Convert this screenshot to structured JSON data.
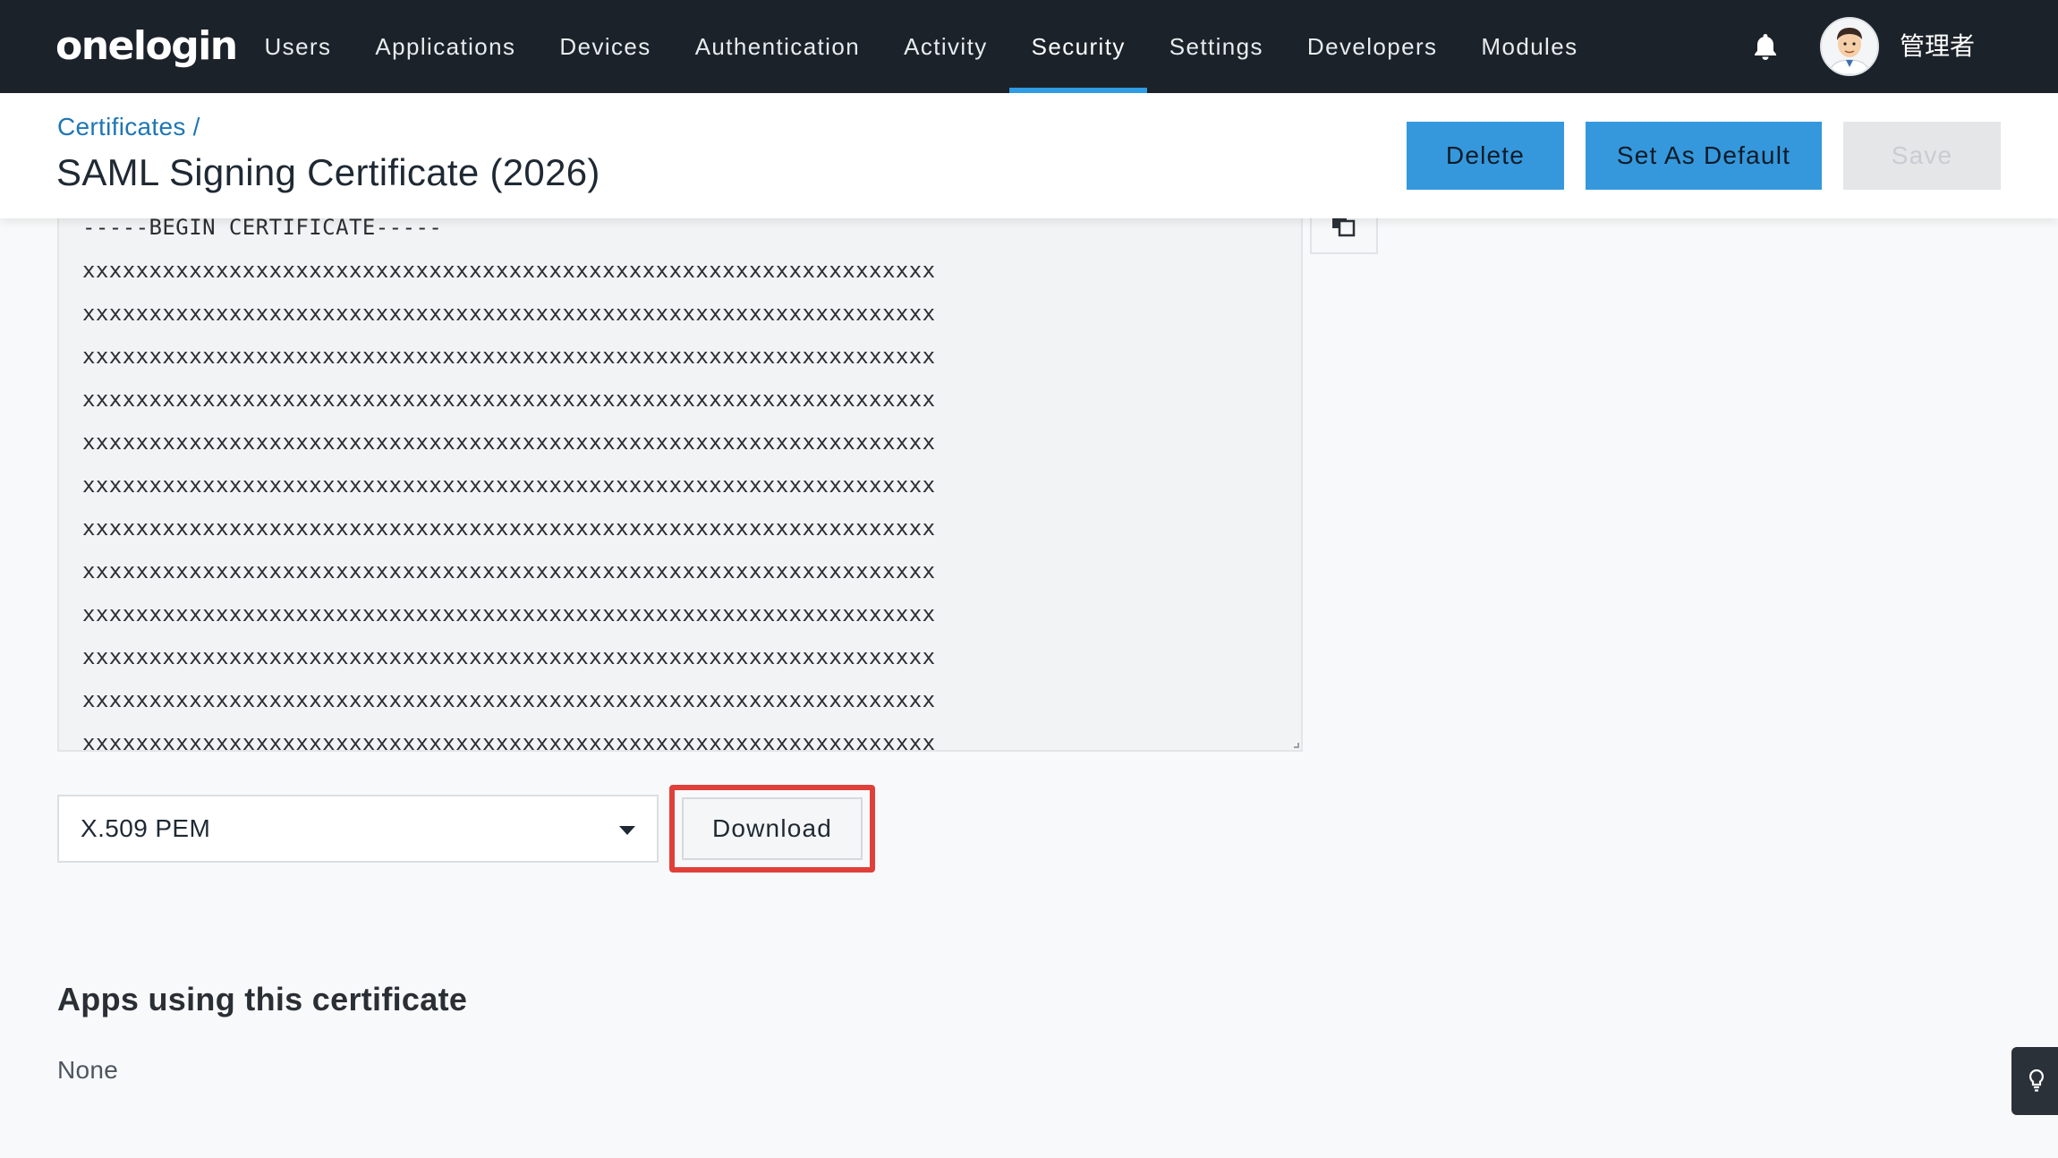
{
  "brand": {
    "logo_text": "onelogin",
    "accent_color": "#2f9be3",
    "nav_bg": "#1c2229"
  },
  "nav": {
    "items": [
      {
        "label": "Users"
      },
      {
        "label": "Applications"
      },
      {
        "label": "Devices"
      },
      {
        "label": "Authentication"
      },
      {
        "label": "Activity"
      },
      {
        "label": "Security",
        "active": true
      },
      {
        "label": "Settings"
      },
      {
        "label": "Developers"
      },
      {
        "label": "Modules"
      }
    ],
    "notification_icon": "bell-icon",
    "user_name": "管理者"
  },
  "header": {
    "breadcrumb": "Certificates",
    "breadcrumb_separator": "/",
    "title": "SAML Signing Certificate (2026)",
    "buttons": {
      "delete": "Delete",
      "set_default": "Set As Default",
      "save": "Save"
    }
  },
  "certificate": {
    "lines": [
      "-----BEGIN CERTIFICATE-----",
      "xxxxxxxxxxxxxxxxxxxxxxxxxxxxxxxxxxxxxxxxxxxxxxxxxxxxxxxxxxxxxxxx",
      "xxxxxxxxxxxxxxxxxxxxxxxxxxxxxxxxxxxxxxxxxxxxxxxxxxxxxxxxxxxxxxxx",
      "xxxxxxxxxxxxxxxxxxxxxxxxxxxxxxxxxxxxxxxxxxxxxxxxxxxxxxxxxxxxxxxx",
      "xxxxxxxxxxxxxxxxxxxxxxxxxxxxxxxxxxxxxxxxxxxxxxxxxxxxxxxxxxxxxxxx",
      "xxxxxxxxxxxxxxxxxxxxxxxxxxxxxxxxxxxxxxxxxxxxxxxxxxxxxxxxxxxxxxxx",
      "xxxxxxxxxxxxxxxxxxxxxxxxxxxxxxxxxxxxxxxxxxxxxxxxxxxxxxxxxxxxxxxx",
      "xxxxxxxxxxxxxxxxxxxxxxxxxxxxxxxxxxxxxxxxxxxxxxxxxxxxxxxxxxxxxxxx",
      "xxxxxxxxxxxxxxxxxxxxxxxxxxxxxxxxxxxxxxxxxxxxxxxxxxxxxxxxxxxxxxxx",
      "xxxxxxxxxxxxxxxxxxxxxxxxxxxxxxxxxxxxxxxxxxxxxxxxxxxxxxxxxxxxxxxx",
      "xxxxxxxxxxxxxxxxxxxxxxxxxxxxxxxxxxxxxxxxxxxxxxxxxxxxxxxxxxxxxxxx",
      "xxxxxxxxxxxxxxxxxxxxxxxxxxxxxxxxxxxxxxxxxxxxxxxxxxxxxxxxxxxxxxxx",
      "xxxxxxxxxxxxxxxxxxxxxxxxxxxxxxxxxxxxxxxxxxxxxxxxxxxxxxxxxxxxxxxx"
    ],
    "copy_icon": "copy-icon"
  },
  "download": {
    "format_selected": "X.509 PEM",
    "download_label": "Download",
    "highlight_color": "#e0403a"
  },
  "apps": {
    "title": "Apps using this certificate",
    "value": "None"
  },
  "floating_hint": {
    "icon": "lightbulb-icon"
  }
}
